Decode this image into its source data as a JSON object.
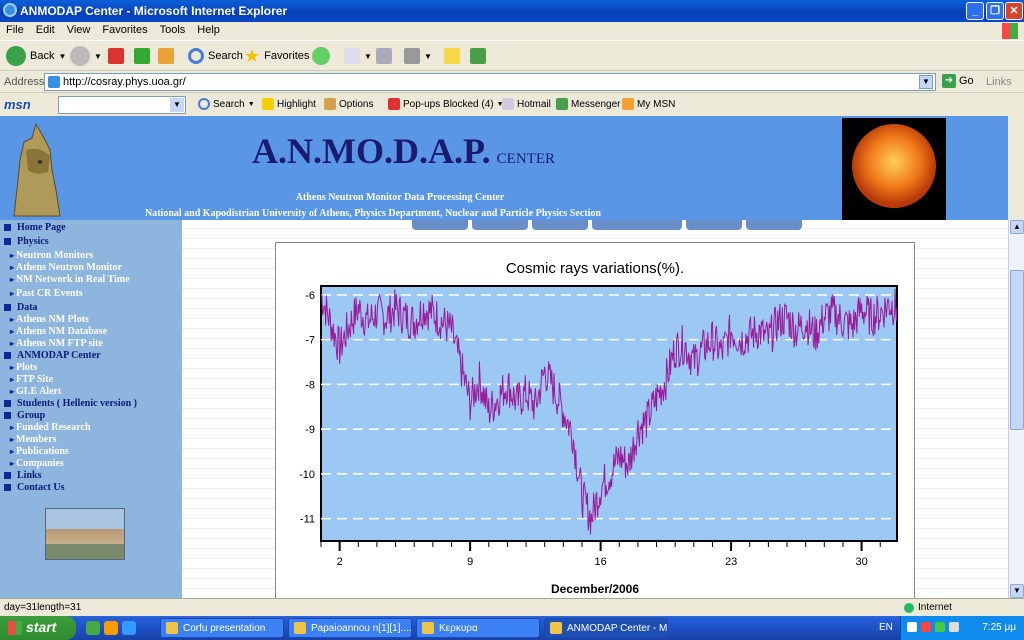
{
  "window": {
    "title": "ANMODAP Center - Microsoft Internet Explorer"
  },
  "menu": [
    "File",
    "Edit",
    "View",
    "Favorites",
    "Tools",
    "Help"
  ],
  "toolbar": {
    "back": "Back",
    "search": "Search",
    "favorites": "Favorites"
  },
  "address": {
    "label": "Address",
    "url": "http://cosray.phys.uoa.gr/",
    "go": "Go",
    "links": "Links"
  },
  "msnbar": {
    "logo": "msn",
    "search": "Search",
    "highlight": "Highlight",
    "options": "Options",
    "popups": "Pop-ups Blocked (4)",
    "hotmail": "Hotmail",
    "messenger": "Messenger",
    "mymsn": "My MSN"
  },
  "banner": {
    "title": "A.N.MO.D.A.P.",
    "title_suffix": "CENTER",
    "subtitle1": "Athens Neutron Monitor Data Processing Center",
    "subtitle2": "National and Kapodistrian University of Athens, Physics Department, Nuclear and Particle Physics Section"
  },
  "sidebar": [
    {
      "label": "Home Page",
      "kind": "main"
    },
    {
      "label": "Physics",
      "kind": "main"
    },
    {
      "label": "Neutron Monitors",
      "kind": "sub"
    },
    {
      "label": "Athens Neutron Monitor",
      "kind": "sub"
    },
    {
      "label": "NM Network in Real Time",
      "kind": "sub"
    },
    {
      "label": "Past CR Events",
      "kind": "sub"
    },
    {
      "label": "Data",
      "kind": "main"
    },
    {
      "label": "Athens NM Plots",
      "kind": "sub"
    },
    {
      "label": "Athens NM Database",
      "kind": "sub"
    },
    {
      "label": "Athens NM FTP site",
      "kind": "sub"
    },
    {
      "label": "ANMODAP Center",
      "kind": "main"
    },
    {
      "label": "Plots",
      "kind": "sub"
    },
    {
      "label": "FTP Site",
      "kind": "sub"
    },
    {
      "label": "GLE Alert",
      "kind": "sub"
    },
    {
      "label": "Students ( Hellenic version )",
      "kind": "main"
    },
    {
      "label": "Group",
      "kind": "main"
    },
    {
      "label": "Funded Research",
      "kind": "sub"
    },
    {
      "label": "Members",
      "kind": "sub"
    },
    {
      "label": "Publications",
      "kind": "sub"
    },
    {
      "label": "Companies",
      "kind": "sub"
    },
    {
      "label": "Links",
      "kind": "main"
    },
    {
      "label": "Contact Us",
      "kind": "main"
    }
  ],
  "status": {
    "text": "day=31length=31",
    "zone": "Internet"
  },
  "taskbar": {
    "start": "start",
    "tasks": [
      "Corfu presentation",
      "Papaioannou n[1][1]....",
      "Κερκυρα",
      "ANMODAP Center - M..."
    ],
    "lang": "EN",
    "clock": "7:25 μμ"
  },
  "colors": {
    "plot_bg": "#9cc9f3",
    "series": "#9b1a9b",
    "banner": "#5a96e6",
    "sidebar": "#8db5de"
  },
  "chart_data": {
    "type": "line",
    "title": "Cosmic rays variations(%).",
    "xlabel": "December/2006",
    "ylabel": "",
    "xlim": [
      1,
      31.9
    ],
    "ylim": [
      -11.5,
      -5.8
    ],
    "xticks": [
      2,
      9,
      16,
      23,
      30
    ],
    "yticks": [
      -6,
      -7,
      -8,
      -9,
      -10,
      -11
    ],
    "grid": "horizontal dashed",
    "series": [
      {
        "x": [
          1,
          1.5,
          2,
          2.5,
          3,
          3.5,
          4,
          4.5,
          5,
          5.5,
          6,
          6.5,
          7,
          7.5,
          8,
          8.5,
          9,
          9.5,
          10,
          10.5,
          11,
          11.5,
          12,
          12.5,
          13,
          13.5,
          14,
          14.5,
          15,
          15.5,
          16,
          16.5,
          17,
          17.5,
          18,
          18.5,
          19,
          19.5,
          20,
          20.5,
          21,
          21.5,
          22,
          22.5,
          23,
          23.5,
          24,
          24.5,
          25,
          25.5,
          26,
          26.5,
          27,
          27.5,
          28,
          28.5,
          29,
          29.5,
          30,
          30.5,
          31,
          31.5,
          31.9
        ],
        "values": [
          -6.0,
          -6.6,
          -7.2,
          -6.7,
          -6.3,
          -6.6,
          -6.4,
          -6.5,
          -6.3,
          -6.5,
          -6.6,
          -6.3,
          -6.4,
          -6.6,
          -6.8,
          -7.6,
          -8.4,
          -7.9,
          -8.6,
          -8.3,
          -8.0,
          -8.4,
          -8.2,
          -8.5,
          -7.7,
          -8.1,
          -8.6,
          -9.1,
          -10.5,
          -11.0,
          -10.3,
          -10.0,
          -9.6,
          -9.8,
          -9.0,
          -8.8,
          -8.3,
          -7.9,
          -7.2,
          -7.1,
          -7.5,
          -7.2,
          -7.0,
          -7.3,
          -6.8,
          -7.0,
          -6.9,
          -6.8,
          -7.0,
          -6.6,
          -6.5,
          -6.8,
          -6.6,
          -6.9,
          -6.5,
          -6.4,
          -6.6,
          -6.7,
          -6.3,
          -6.5,
          -6.4,
          -6.2,
          -6.3
        ]
      }
    ]
  }
}
